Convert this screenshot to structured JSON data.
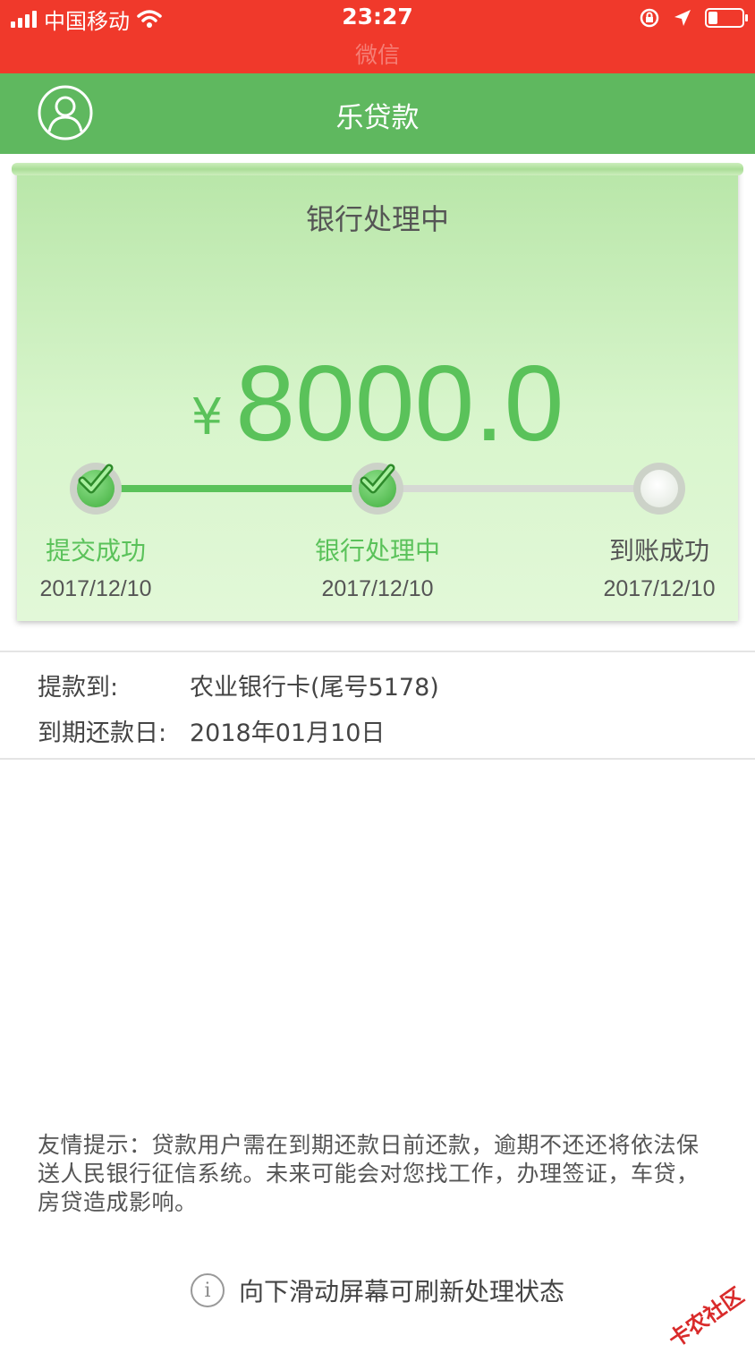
{
  "status_bar": {
    "carrier": "中国移动",
    "time": "23:27",
    "app_return": "微信"
  },
  "nav": {
    "title": "乐贷款",
    "icons": [
      "user-avatar-icon"
    ]
  },
  "card": {
    "status": "银行处理中",
    "currency_symbol": "¥",
    "amount": "8000.0",
    "progress_completed_steps": 2,
    "steps": [
      {
        "label": "提交成功",
        "date": "2017/12/10",
        "state": "done"
      },
      {
        "label": "银行处理中",
        "date": "2017/12/10",
        "state": "done"
      },
      {
        "label": "到账成功",
        "date": "2017/12/10",
        "state": "todo"
      }
    ]
  },
  "details": {
    "withdraw_label": "提款到:",
    "withdraw_value": "农业银行卡(尾号5178)",
    "due_label": "到期还款日:",
    "due_value": "2018年01月10日"
  },
  "notice": "友情提示：贷款用户需在到期还款日前还款，逾期不还还将依法保送人民银行征信系统。未来可能会对您找工作，办理签证，车贷，房贷造成影响。",
  "hint": {
    "icon_glyph": "i",
    "text": "向下滑动屏幕可刷新处理状态"
  },
  "watermark": "卡农社区",
  "colors": {
    "status_bar": "#f0392b",
    "nav_bar": "#5fb85f",
    "accent_green": "#5ac25a"
  }
}
